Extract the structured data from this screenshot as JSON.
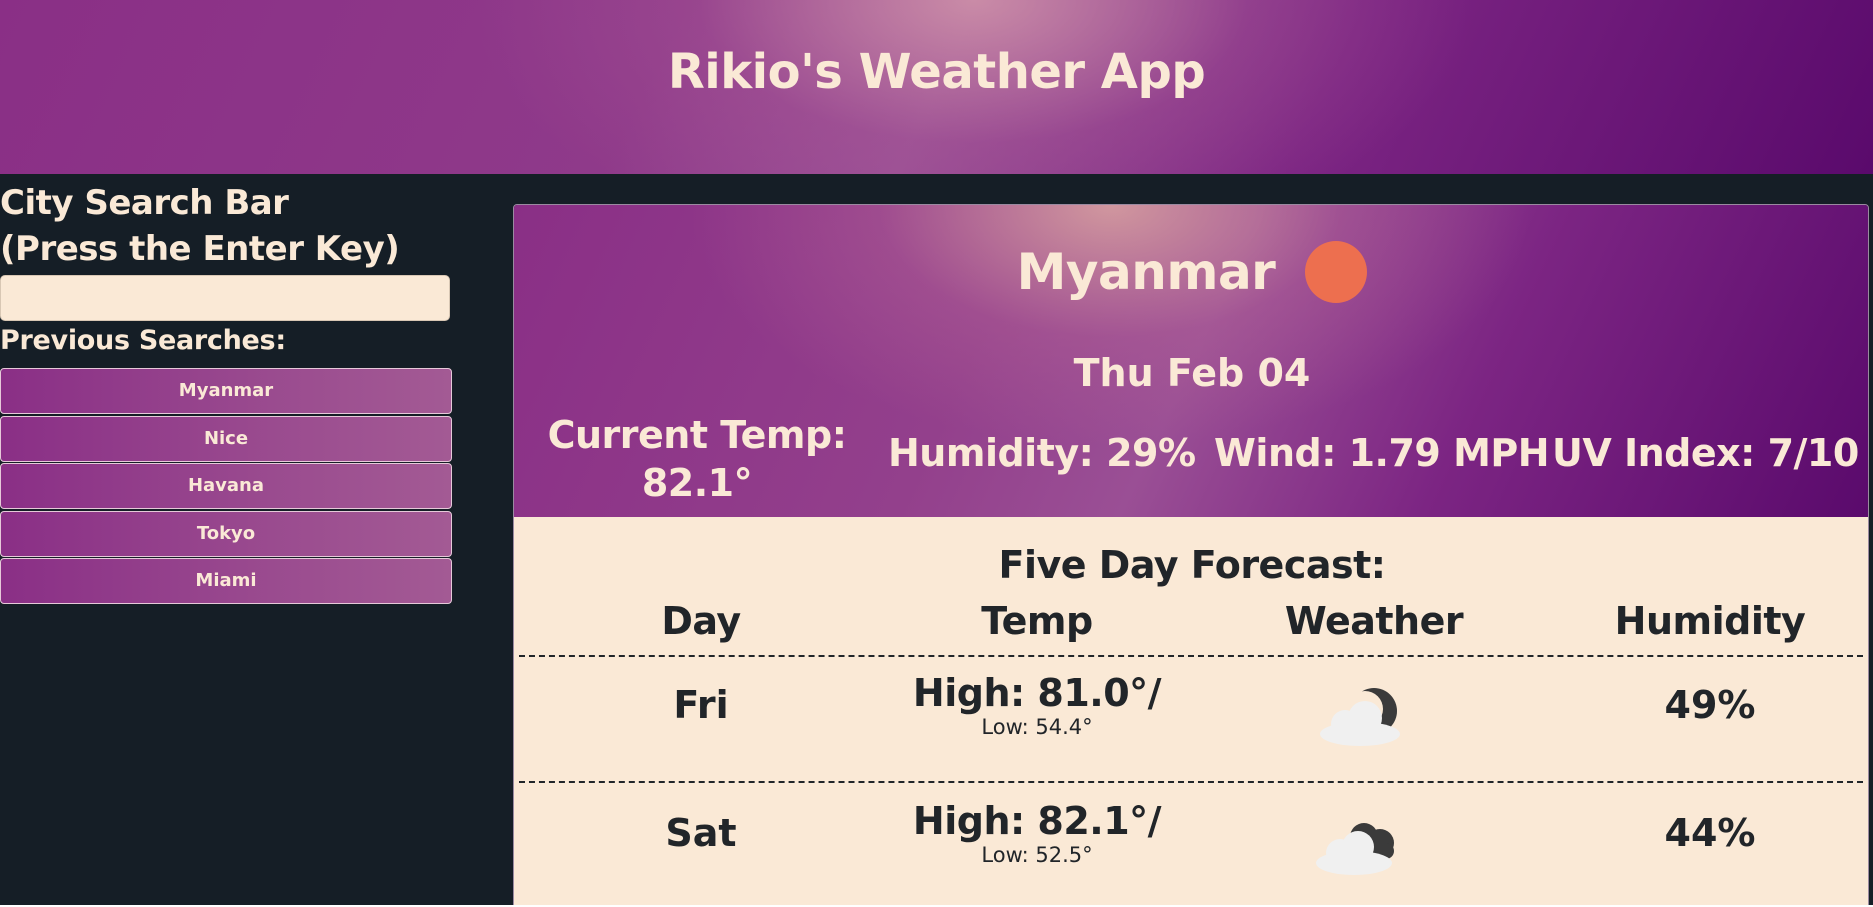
{
  "header": {
    "title": "Rikio's Weather App"
  },
  "sidebar": {
    "search_heading_line1": "City Search Bar",
    "search_heading_line2": "(Press the Enter Key)",
    "search_value": "",
    "previous_label": "Previous Searches:",
    "history": [
      "Myanmar",
      "Nice",
      "Havana",
      "Tokyo",
      "Miami"
    ]
  },
  "current": {
    "city": "Myanmar",
    "icon": "sun-icon",
    "icon_color": "#ed6f4f",
    "date": "Thu Feb 04",
    "temp_label": "Current Temp:",
    "temp_value": "82.1°",
    "humidity": "Humidity: 29%",
    "wind": "Wind: 1.79 MPH",
    "uv": "UV Index: 7/10"
  },
  "forecast": {
    "title": "Five Day Forecast:",
    "columns": [
      "Day",
      "Temp",
      "Weather",
      "Humidity"
    ],
    "rows": [
      {
        "day": "Fri",
        "high": "High: 81.0°/",
        "low": "Low: 54.4°",
        "icon": "night-cloud-icon",
        "humidity": "49%"
      },
      {
        "day": "Sat",
        "high": "High: 82.1°/",
        "low": "Low: 52.5°",
        "icon": "cloudy-icon",
        "humidity": "44%"
      }
    ]
  },
  "colors": {
    "accent": "#8a2f86",
    "cream": "#fae9d6",
    "background": "#151e26",
    "text_dark": "#212529"
  }
}
